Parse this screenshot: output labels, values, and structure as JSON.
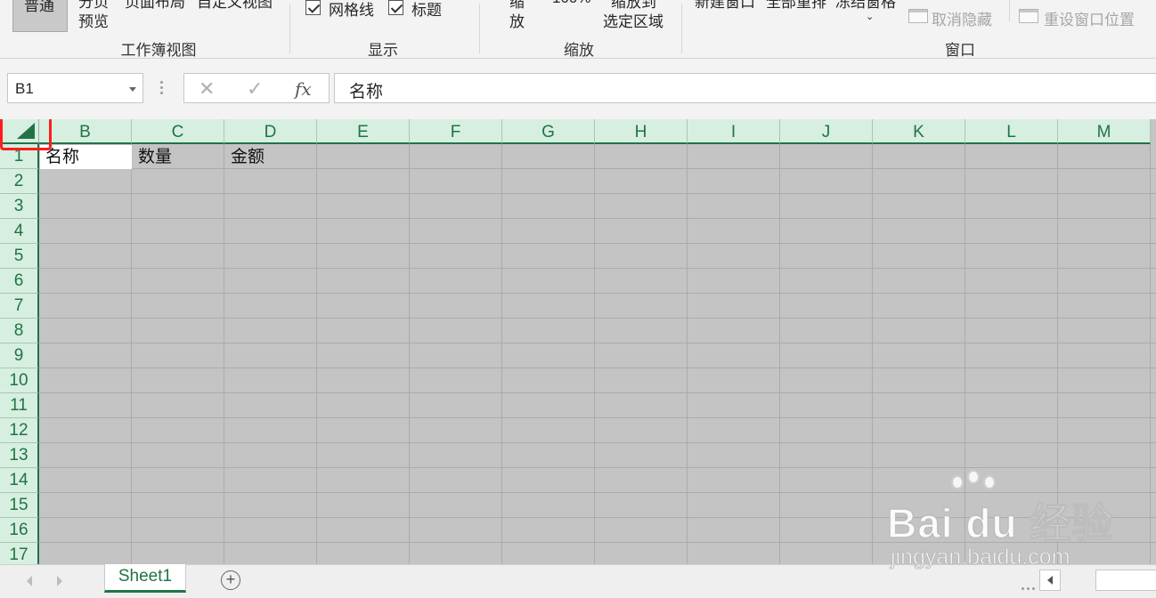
{
  "ribbon": {
    "normal_btn": "普通",
    "pagebreak_btn": "分页",
    "pagelayout_btn": "页面布局",
    "customview_btn": "自定义视图",
    "preview_label": "预览",
    "workbook_views_label": "工作簿视图",
    "gridlines_label": "网格线",
    "headings_label": "标题",
    "show_label": "显示",
    "zoom_btn_line1": "缩",
    "zoom_btn_line2": "放",
    "zoom100_btn": "100%",
    "zoomsel_line1": "缩放到",
    "zoomsel_line2": "选定区域",
    "zoom_group_label": "缩放",
    "newwindow_btn": "新建窗口",
    "arrangeall_btn": "全部重排",
    "freeze_btn": "冻结窗格",
    "unhide_btn": "取消隐藏",
    "resetpos_btn": "重设窗口位置",
    "window_group_label": "窗口"
  },
  "formula_bar": {
    "name_box": "B1",
    "formula_text": "名称",
    "fx_label": "fx"
  },
  "grid": {
    "columns": [
      "B",
      "C",
      "D",
      "E",
      "F",
      "G",
      "H",
      "I",
      "J",
      "K",
      "L",
      "M"
    ],
    "rows": [
      "1",
      "2",
      "3",
      "4",
      "5",
      "6",
      "7",
      "8",
      "9",
      "10",
      "11",
      "12",
      "13",
      "14",
      "15",
      "16",
      "17"
    ],
    "cells": {
      "B1": "名称",
      "C1": "数量",
      "D1": "金额"
    }
  },
  "sheet_tabs": {
    "active": "Sheet1",
    "add_symbol": "+"
  },
  "watermark": {
    "brand_text": "Bai du 经验",
    "url": "jingyan.baidu.com"
  },
  "colors": {
    "accent": "#217346",
    "header_bg": "#d6efe0",
    "highlight": "#ff1d1d",
    "grid_bg": "#c4c4c4"
  }
}
